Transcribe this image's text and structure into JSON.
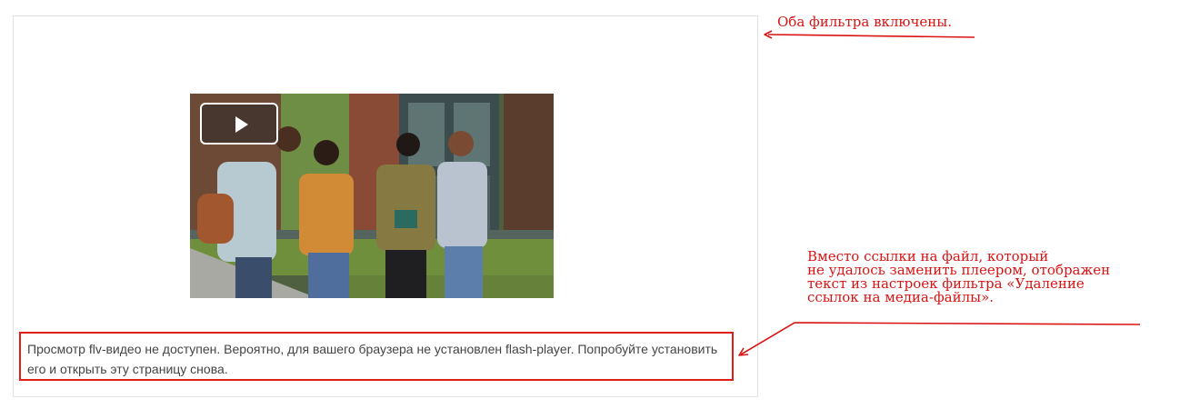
{
  "video": {
    "play_icon": "play-icon"
  },
  "message": {
    "text": "Просмотр flv-видео не доступен. Вероятно, для вашего браузера не установлен flash-player. Попробуйте установить его и открыть эту страницу снова."
  },
  "annotations": {
    "top_note": "Оба фильтра включены.",
    "bottom_note_lines": [
      "Вместо ссылки на файл, который",
      "не удалось заменить плеером, отображен",
      "текст из настроек фильтра «Удаление",
      "ссылок на медиа-файлы»."
    ],
    "color": "#d91414"
  },
  "colors": {
    "highlight_border": "#e01b1b",
    "text": "#444444"
  }
}
